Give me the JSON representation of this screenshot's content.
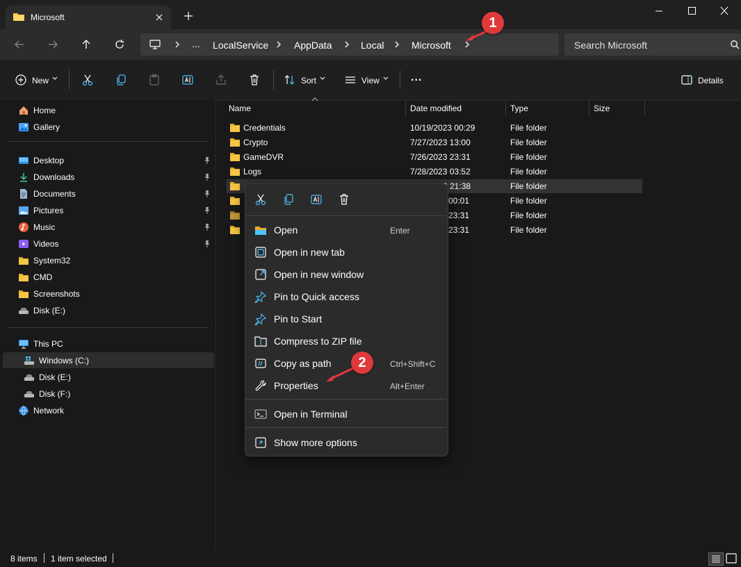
{
  "window": {
    "tab_title": "Microsoft",
    "new_tab_symbol": "+"
  },
  "address": {
    "crumbs": [
      "...",
      "LocalService",
      "AppData",
      "Local",
      "Microsoft"
    ],
    "search_placeholder": "Search Microsoft"
  },
  "toolbar": {
    "new_label": "New",
    "sort_label": "Sort",
    "view_label": "View",
    "more_label": "...",
    "details_label": "Details"
  },
  "sidebar": {
    "quick": [
      {
        "label": "Home",
        "icon": "home-icon"
      },
      {
        "label": "Gallery",
        "icon": "gallery-icon"
      }
    ],
    "pinned": [
      {
        "label": "Desktop",
        "icon": "desktop-icon",
        "pinned": true
      },
      {
        "label": "Downloads",
        "icon": "downloads-icon",
        "pinned": true
      },
      {
        "label": "Documents",
        "icon": "documents-icon",
        "pinned": true
      },
      {
        "label": "Pictures",
        "icon": "pictures-icon",
        "pinned": true
      },
      {
        "label": "Music",
        "icon": "music-icon",
        "pinned": true
      },
      {
        "label": "Videos",
        "icon": "videos-icon",
        "pinned": true
      },
      {
        "label": "System32",
        "icon": "folder-icon",
        "pinned": false
      },
      {
        "label": "CMD",
        "icon": "folder-icon",
        "pinned": false
      },
      {
        "label": "Screenshots",
        "icon": "folder-icon",
        "pinned": false
      },
      {
        "label": "Disk (E:)",
        "icon": "drive-icon",
        "pinned": false
      }
    ],
    "thispc": {
      "label": "This PC",
      "icon": "pc-icon"
    },
    "drives": [
      {
        "label": "Windows (C:)",
        "icon": "windows-drive-icon",
        "selected": true
      },
      {
        "label": "Disk (E:)",
        "icon": "drive-icon",
        "selected": false
      },
      {
        "label": "Disk (F:)",
        "icon": "drive-icon",
        "selected": false
      }
    ],
    "network": {
      "label": "Network",
      "icon": "network-icon"
    }
  },
  "columns": {
    "name": "Name",
    "date": "Date modified",
    "type": "Type",
    "size": "Size"
  },
  "files": [
    {
      "name": "Credentials",
      "date": "10/19/2023 00:29",
      "type": "File folder"
    },
    {
      "name": "Crypto",
      "date": "7/27/2023 13:00",
      "type": "File folder"
    },
    {
      "name": "GameDVR",
      "date": "7/26/2023 23:31",
      "type": "File folder"
    },
    {
      "name": "Logs",
      "date": "7/28/2023 03:52",
      "type": "File folder"
    },
    {
      "name": "",
      "date": "3 21:38",
      "type": "File folder",
      "selected": true
    },
    {
      "name": "",
      "date": "00:01",
      "type": "File folder"
    },
    {
      "name": "",
      "date": "23:31",
      "type": "File folder"
    },
    {
      "name": "",
      "date": "23:31",
      "type": "File folder"
    }
  ],
  "context_menu": {
    "toolbar_icons": [
      "cut-icon",
      "copy-icon",
      "rename-icon",
      "delete-icon"
    ],
    "items": [
      {
        "label": "Open",
        "shortcut": "Enter",
        "icon": "open-folder-icon"
      },
      {
        "label": "Open in new tab",
        "shortcut": "",
        "icon": "new-tab-icon"
      },
      {
        "label": "Open in new window",
        "shortcut": "",
        "icon": "new-window-icon"
      },
      {
        "label": "Pin to Quick access",
        "shortcut": "",
        "icon": "pin-icon"
      },
      {
        "label": "Pin to Start",
        "shortcut": "",
        "icon": "pin-icon"
      },
      {
        "label": "Compress to ZIP file",
        "shortcut": "",
        "icon": "zip-icon"
      },
      {
        "label": "Copy as path",
        "shortcut": "Ctrl+Shift+C",
        "icon": "copy-path-icon"
      },
      {
        "label": "Properties",
        "shortcut": "Alt+Enter",
        "icon": "wrench-icon"
      }
    ],
    "extra": [
      {
        "label": "Open in Terminal",
        "icon": "terminal-icon"
      },
      {
        "label": "Show more options",
        "icon": "more-options-icon"
      }
    ]
  },
  "annotations": {
    "badge1": "1",
    "badge2": "2",
    "color": "#e0393b"
  },
  "status": {
    "items_count": "8 items",
    "selected_count": "1 item selected"
  },
  "colors": {
    "folder": "#f6c544",
    "accent": "#4cc2ff"
  }
}
